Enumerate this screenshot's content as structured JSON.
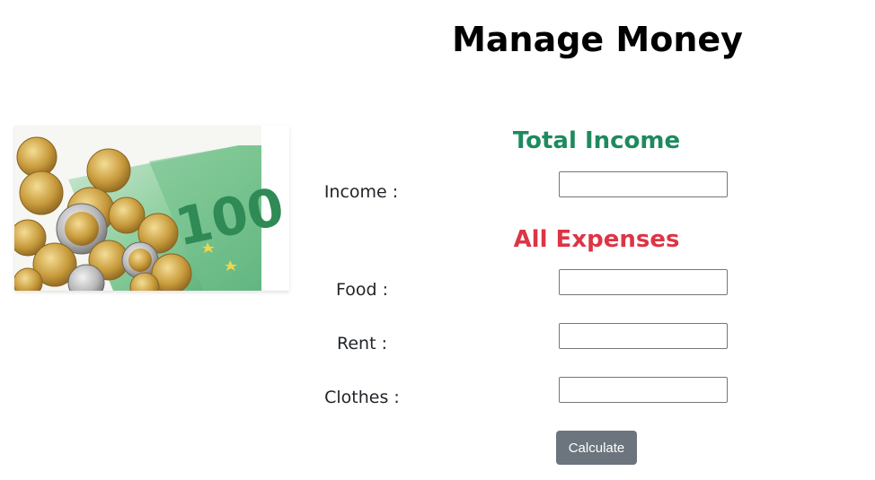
{
  "page": {
    "title": "Manage Money"
  },
  "colors": {
    "income_heading": "#1e8a5e",
    "expenses_heading": "#dc3545",
    "button_bg": "#6c757d",
    "button_text": "#ffffff"
  },
  "hero": {
    "image_name": "euro-coins-and-banknote",
    "banknote_denomination": "100"
  },
  "income_section": {
    "heading": "Total Income",
    "fields": [
      {
        "label": "Income :",
        "value": "",
        "placeholder": ""
      }
    ]
  },
  "expenses_section": {
    "heading": "All Expenses",
    "fields": [
      {
        "label": "Food :",
        "value": "",
        "placeholder": ""
      },
      {
        "label": "Rent :",
        "value": "",
        "placeholder": ""
      },
      {
        "label": "Clothes :",
        "value": "",
        "placeholder": ""
      }
    ]
  },
  "actions": {
    "calculate_label": "Calculate"
  }
}
